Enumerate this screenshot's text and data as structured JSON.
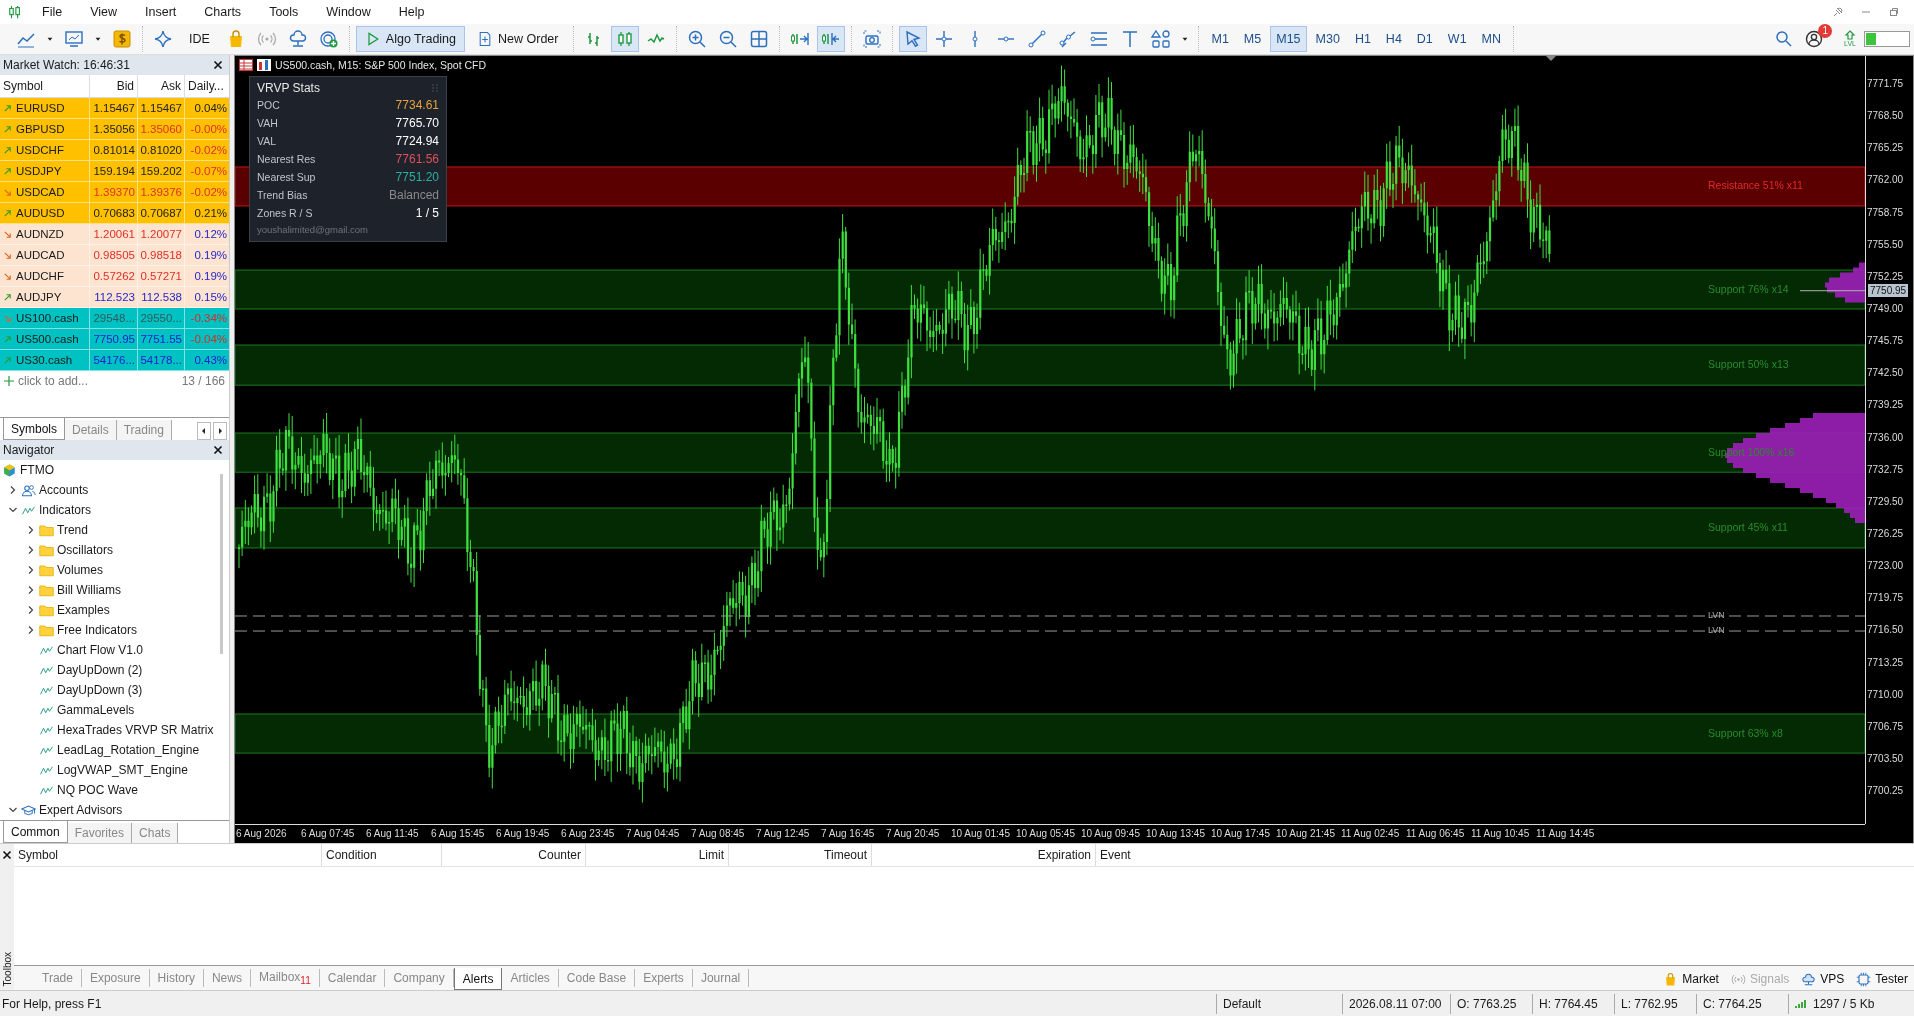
{
  "menu": [
    "File",
    "View",
    "Insert",
    "Charts",
    "Tools",
    "Window",
    "Help"
  ],
  "toolbar": {
    "groups": [
      [
        {
          "kind": "line-chart",
          "pressed": false
        },
        {
          "kind": "caret",
          "pressed": false
        },
        {
          "kind": "chart-window",
          "pressed": false
        },
        {
          "kind": "caret",
          "pressed": false
        },
        {
          "kind": "dollar",
          "pressed": false
        }
      ],
      [
        {
          "kind": "sparkle",
          "pressed": false
        },
        {
          "kind": "ide",
          "label": "IDE",
          "pressed": false
        },
        {
          "kind": "bag",
          "pressed": false
        },
        {
          "kind": "broadcast",
          "pressed": false
        },
        {
          "kind": "cloud",
          "pressed": false
        },
        {
          "kind": "target-add",
          "pressed": false
        }
      ],
      [
        {
          "kind": "algo",
          "label": "Algo Trading",
          "pressed": true
        },
        {
          "kind": "order",
          "label": "New Order",
          "pressed": false
        }
      ],
      [
        {
          "kind": "bars",
          "pressed": false
        },
        {
          "kind": "candles",
          "pressed": true
        },
        {
          "kind": "line",
          "pressed": false
        }
      ],
      [
        {
          "kind": "zoom-in",
          "pressed": false
        },
        {
          "kind": "zoom-out",
          "pressed": false
        },
        {
          "kind": "grid",
          "pressed": false
        }
      ],
      [
        {
          "kind": "autoscroll",
          "pressed": false
        },
        {
          "kind": "shift",
          "pressed": true
        }
      ],
      [
        {
          "kind": "camera",
          "pressed": false
        }
      ],
      [
        {
          "kind": "cursor",
          "pressed": true
        },
        {
          "kind": "crosshair",
          "pressed": false
        },
        {
          "kind": "vline",
          "pressed": false
        },
        {
          "kind": "hline",
          "pressed": false
        },
        {
          "kind": "trendline",
          "pressed": false
        },
        {
          "kind": "trend-nodes",
          "pressed": false
        },
        {
          "kind": "channel",
          "pressed": false
        },
        {
          "kind": "text-tool",
          "pressed": false
        },
        {
          "kind": "shapes",
          "pressed": false
        },
        {
          "kind": "caret",
          "pressed": false
        }
      ]
    ],
    "timeframes": [
      {
        "label": "M1",
        "selected": false
      },
      {
        "label": "M5",
        "selected": false
      },
      {
        "label": "M15",
        "selected": true
      },
      {
        "label": "M30",
        "selected": false
      },
      {
        "label": "H1",
        "selected": false
      },
      {
        "label": "H4",
        "selected": false
      },
      {
        "label": "D1",
        "selected": false
      },
      {
        "label": "W1",
        "selected": false
      },
      {
        "label": "MN",
        "selected": false
      }
    ],
    "notification_badge": "1",
    "lvl_label": "LVL"
  },
  "market_watch": {
    "title": "Market Watch: 16:46:31",
    "columns": [
      "Symbol",
      "Bid",
      "Ask",
      "Daily..."
    ],
    "rows": [
      {
        "symbol": "EURUSD",
        "rising": true,
        "color": "#ffc000",
        "bid": {
          "value": "1.15467",
          "color": "#222222"
        },
        "ask": {
          "value": "1.15467",
          "color": "#222222"
        },
        "daily": {
          "value": "0.04%",
          "color": "#222222"
        }
      },
      {
        "symbol": "GBPUSD",
        "rising": true,
        "color": "#ffc000",
        "bid": {
          "value": "1.35056",
          "color": "#222222"
        },
        "ask": {
          "value": "1.35060",
          "color": "#e0302a"
        },
        "daily": {
          "value": "-0.00%",
          "color": "#e0302a"
        }
      },
      {
        "symbol": "USDCHF",
        "rising": true,
        "color": "#ffc000",
        "bid": {
          "value": "0.81014",
          "color": "#222222"
        },
        "ask": {
          "value": "0.81020",
          "color": "#222222"
        },
        "daily": {
          "value": "-0.02%",
          "color": "#e0302a"
        }
      },
      {
        "symbol": "USDJPY",
        "rising": true,
        "color": "#ffc000",
        "bid": {
          "value": "159.194",
          "color": "#222222"
        },
        "ask": {
          "value": "159.202",
          "color": "#222222"
        },
        "daily": {
          "value": "-0.07%",
          "color": "#e0302a"
        }
      },
      {
        "symbol": "USDCAD",
        "rising": false,
        "color": "#ffc000",
        "bid": {
          "value": "1.39370",
          "color": "#e0302a"
        },
        "ask": {
          "value": "1.39376",
          "color": "#e0302a"
        },
        "daily": {
          "value": "-0.02%",
          "color": "#e0302a"
        }
      },
      {
        "symbol": "AUDUSD",
        "rising": true,
        "color": "#ffc000",
        "bid": {
          "value": "0.70683",
          "color": "#222222"
        },
        "ask": {
          "value": "0.70687",
          "color": "#222222"
        },
        "daily": {
          "value": "0.21%",
          "color": "#222222"
        }
      },
      {
        "symbol": "AUDNZD",
        "rising": false,
        "color": "#fde4d0",
        "bid": {
          "value": "1.20061",
          "color": "#e0302a"
        },
        "ask": {
          "value": "1.20077",
          "color": "#e0302a"
        },
        "daily": {
          "value": "0.12%",
          "color": "#2626c8"
        }
      },
      {
        "symbol": "AUDCAD",
        "rising": false,
        "color": "#fde4d0",
        "bid": {
          "value": "0.98505",
          "color": "#e0302a"
        },
        "ask": {
          "value": "0.98518",
          "color": "#e0302a"
        },
        "daily": {
          "value": "0.19%",
          "color": "#2626c8"
        }
      },
      {
        "symbol": "AUDCHF",
        "rising": false,
        "color": "#fde4d0",
        "bid": {
          "value": "0.57262",
          "color": "#e0302a"
        },
        "ask": {
          "value": "0.57271",
          "color": "#e0302a"
        },
        "daily": {
          "value": "0.19%",
          "color": "#2626c8"
        }
      },
      {
        "symbol": "AUDJPY",
        "rising": true,
        "color": "#fde4d0",
        "bid": {
          "value": "112.523",
          "color": "#2626c8"
        },
        "ask": {
          "value": "112.538",
          "color": "#2626c8"
        },
        "daily": {
          "value": "0.15%",
          "color": "#2626c8"
        }
      },
      {
        "symbol": "US100.cash",
        "rising": false,
        "color": "#00c2c2",
        "bid": {
          "value": "29548...",
          "color": "#2f5c5c"
        },
        "ask": {
          "value": "29550...",
          "color": "#2f5c5c"
        },
        "daily": {
          "value": "-0.34%",
          "color": "#d0302a"
        }
      },
      {
        "symbol": "US500.cash",
        "rising": true,
        "color": "#00c2c2",
        "bid": {
          "value": "7750.95",
          "color": "#2020d0"
        },
        "ask": {
          "value": "7751.55",
          "color": "#2020d0"
        },
        "daily": {
          "value": "-0.04%",
          "color": "#d0302a"
        }
      },
      {
        "symbol": "US30.cash",
        "rising": true,
        "color": "#00c2c2",
        "bid": {
          "value": "54176...",
          "color": "#2020d0"
        },
        "ask": {
          "value": "54178...",
          "color": "#2020d0"
        },
        "daily": {
          "value": "0.43%",
          "color": "#2020d0"
        }
      }
    ],
    "add_label": "click to add...",
    "count": "13 / 166",
    "tabs": [
      {
        "label": "Symbols",
        "selected": true
      },
      {
        "label": "Details",
        "selected": false
      },
      {
        "label": "Trading",
        "selected": false
      }
    ]
  },
  "navigator": {
    "title": "Navigator",
    "tree": [
      {
        "label": "FTMO",
        "kind": "broker",
        "children": [
          {
            "label": "Accounts",
            "kind": "accounts",
            "expanded": false
          },
          {
            "label": "Indicators",
            "kind": "indicators",
            "expanded": true,
            "children": [
              {
                "label": "Trend",
                "kind": "folder",
                "expanded": false
              },
              {
                "label": "Oscillators",
                "kind": "folder",
                "expanded": false
              },
              {
                "label": "Volumes",
                "kind": "folder",
                "expanded": false
              },
              {
                "label": "Bill Williams",
                "kind": "folder",
                "expanded": false
              },
              {
                "label": "Examples",
                "kind": "folder",
                "expanded": false
              },
              {
                "label": "Free Indicators",
                "kind": "folder",
                "expanded": false
              },
              {
                "label": "Chart Flow V1.0",
                "kind": "indicator"
              },
              {
                "label": "DayUpDown (2)",
                "kind": "indicator"
              },
              {
                "label": "DayUpDown (3)",
                "kind": "indicator"
              },
              {
                "label": "GammaLevels",
                "kind": "indicator"
              },
              {
                "label": "HexaTrades VRVP SR Matrix",
                "kind": "indicator"
              },
              {
                "label": "LeadLag_Rotation_Engine",
                "kind": "indicator"
              },
              {
                "label": "LogVWAP_SMT_Engine",
                "kind": "indicator"
              },
              {
                "label": "NQ POC Wave",
                "kind": "indicator"
              }
            ]
          },
          {
            "label": "Expert Advisors",
            "kind": "experts",
            "expanded": true
          }
        ]
      }
    ],
    "tabs": [
      {
        "label": "Common",
        "selected": true
      },
      {
        "label": "Favorites",
        "selected": false
      },
      {
        "label": "Chats",
        "selected": false
      }
    ]
  },
  "chart": {
    "title": "US500.cash, M15:  S&P 500 Index, Spot CFD",
    "stats": {
      "title": "VRVP Stats",
      "rows": [
        {
          "label": "POC",
          "value": "7734.61",
          "color": "#e8a33d"
        },
        {
          "label": "VAH",
          "value": "7765.70",
          "color": "#ffffff"
        },
        {
          "label": "VAL",
          "value": "7724.94",
          "color": "#ffffff"
        },
        {
          "label": "Nearest Res",
          "value": "7761.56",
          "color": "#e0505a"
        },
        {
          "label": "Nearest Sup",
          "value": "7751.20",
          "color": "#2ab0a0"
        },
        {
          "label": "Trend Bias",
          "value": "Balanced",
          "color": "#8a8a8a"
        },
        {
          "label": "Zones R / S",
          "value": "1 / 5",
          "color": "#ffffff"
        }
      ],
      "footer": "youshalimited@gmail.com"
    },
    "zones": [
      {
        "kind": "resistance",
        "label": "Resistance 51%  x11"
      },
      {
        "kind": "support",
        "label": "Support 76%  x14"
      },
      {
        "kind": "support",
        "label": "Support 50%  x13"
      },
      {
        "kind": "support",
        "label": "Support 100%  x16"
      },
      {
        "kind": "support",
        "label": "Support 45%  x11"
      },
      {
        "kind": "support",
        "label": "Support 63%  x8"
      }
    ],
    "lvn_lines": [
      {
        "label": "LVN"
      },
      {
        "label": "LVN"
      }
    ],
    "current_price": "7750.95",
    "price_axis": [
      "7771.75",
      "7768.50",
      "7765.25",
      "7762.00",
      "7758.75",
      "7755.50",
      "7752.25",
      "7749.00",
      "7745.75",
      "7742.50",
      "7739.25",
      "7736.00",
      "7732.75",
      "7729.50",
      "7726.25",
      "7723.00",
      "7719.75",
      "7716.50",
      "7713.25",
      "7710.00",
      "7706.75",
      "7703.50",
      "7700.25"
    ],
    "time_axis": [
      "6 Aug 2026",
      "6 Aug 07:45",
      "6 Aug 11:45",
      "6 Aug 15:45",
      "6 Aug 19:45",
      "6 Aug 23:45",
      "7 Aug 04:45",
      "7 Aug 08:45",
      "7 Aug 12:45",
      "7 Aug 16:45",
      "7 Aug 20:45",
      "10 Aug 01:45",
      "10 Aug 05:45",
      "10 Aug 09:45",
      "10 Aug 13:45",
      "10 Aug 17:45",
      "10 Aug 21:45",
      "11 Aug 02:45",
      "11 Aug 06:45",
      "11 Aug 10:45",
      "11 Aug 14:45"
    ]
  },
  "toolbox": {
    "title": "Toolbox",
    "columns": [
      {
        "label": "Symbol",
        "right_aligned": false
      },
      {
        "label": "Condition",
        "right_aligned": false
      },
      {
        "label": "Counter",
        "right_aligned": true
      },
      {
        "label": "Limit",
        "right_aligned": true
      },
      {
        "label": "Timeout",
        "right_aligned": true
      },
      {
        "label": "Expiration",
        "right_aligned": true
      },
      {
        "label": "Event",
        "right_aligned": false
      }
    ],
    "tabs": [
      {
        "label": "Trade",
        "selected": false
      },
      {
        "label": "Exposure",
        "selected": false
      },
      {
        "label": "History",
        "selected": false
      },
      {
        "label": "News",
        "selected": false
      },
      {
        "label": "Mailbox",
        "badge": "11",
        "selected": false
      },
      {
        "label": "Calendar",
        "selected": false
      },
      {
        "label": "Company",
        "selected": false
      },
      {
        "label": "Alerts",
        "selected": true
      },
      {
        "label": "Articles",
        "selected": false
      },
      {
        "label": "Code Base",
        "selected": false
      },
      {
        "label": "Experts",
        "selected": false
      },
      {
        "label": "Journal",
        "selected": false
      }
    ],
    "services": [
      {
        "label": "Market",
        "kind": "market",
        "disabled": false
      },
      {
        "label": "Signals",
        "kind": "signals",
        "disabled": true
      },
      {
        "label": "VPS",
        "kind": "vps",
        "disabled": false
      },
      {
        "label": "Tester",
        "kind": "tester",
        "disabled": false
      }
    ]
  },
  "status_bar": {
    "help": "For Help, press F1",
    "cells": [
      "Default",
      "2026.08.11 07:00",
      "O: 7763.25",
      "H: 7764.45",
      "L: 7762.95",
      "C: 7764.25"
    ],
    "traffic": "1297 / 5 Kb"
  }
}
